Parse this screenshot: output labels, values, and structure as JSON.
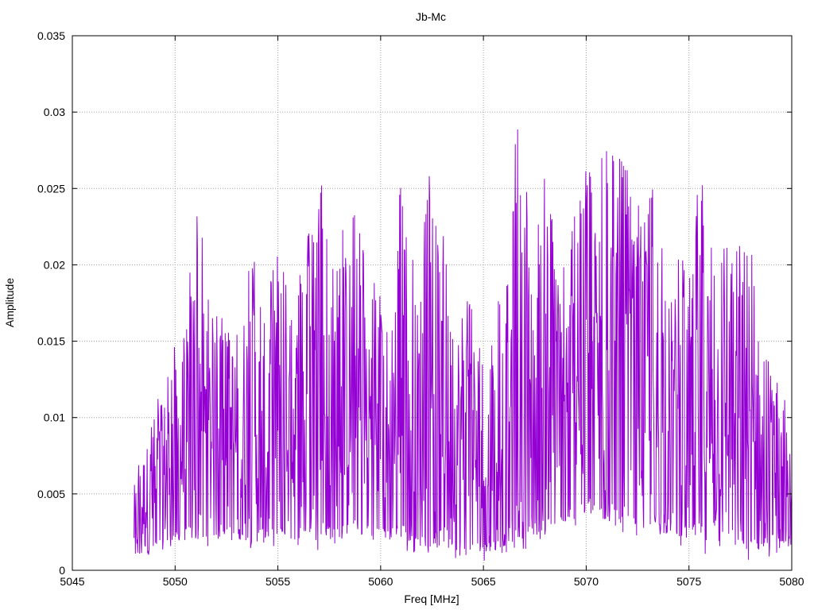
{
  "chart_data": {
    "type": "line",
    "title": "Jb-Mc",
    "xlabel": "Freq [MHz]",
    "ylabel": "Amplitude",
    "xlim": [
      5045,
      5080
    ],
    "ylim": [
      0,
      0.035
    ],
    "grid": true,
    "line_color": "#9400d3",
    "x_ticks": [
      5045,
      5050,
      5055,
      5060,
      5065,
      5070,
      5075,
      5080
    ],
    "x_tick_labels": [
      "5045",
      "5050",
      "5055",
      "5060",
      "5065",
      "5070",
      "5075",
      "5080"
    ],
    "y_ticks": [
      0,
      0.005,
      0.01,
      0.015,
      0.02,
      0.025,
      0.03,
      0.035
    ],
    "y_tick_labels": [
      "0",
      "0.005",
      "0.01",
      "0.015",
      "0.02",
      "0.025",
      "0.03",
      "0.035"
    ],
    "series": [
      {
        "x_start": 5048.0,
        "x_end": 5080.0,
        "envelope_peaks": [
          [
            5048.0,
            0.0062
          ],
          [
            5048.5,
            0.009
          ],
          [
            5049.0,
            0.0105
          ],
          [
            5049.5,
            0.013
          ],
          [
            5050.0,
            0.015
          ],
          [
            5050.5,
            0.017
          ],
          [
            5050.8,
            0.0218
          ],
          [
            5051.1,
            0.0263
          ],
          [
            5051.5,
            0.018
          ],
          [
            5052.0,
            0.017
          ],
          [
            5052.5,
            0.0175
          ],
          [
            5053.0,
            0.018
          ],
          [
            5053.5,
            0.02
          ],
          [
            5053.7,
            0.024
          ],
          [
            5054.0,
            0.018
          ],
          [
            5054.5,
            0.0185
          ],
          [
            5054.9,
            0.0252
          ],
          [
            5055.5,
            0.0185
          ],
          [
            5056.0,
            0.0195
          ],
          [
            5056.5,
            0.0224
          ],
          [
            5056.9,
            0.0248
          ],
          [
            5057.4,
            0.0274
          ],
          [
            5057.9,
            0.02
          ],
          [
            5058.3,
            0.0242
          ],
          [
            5058.9,
            0.0238
          ],
          [
            5059.5,
            0.02
          ],
          [
            5060.0,
            0.018
          ],
          [
            5060.5,
            0.019
          ],
          [
            5060.9,
            0.0279
          ],
          [
            5061.4,
            0.021
          ],
          [
            5061.8,
            0.02
          ],
          [
            5062.4,
            0.0264
          ],
          [
            5062.9,
            0.026
          ],
          [
            5063.5,
            0.016
          ],
          [
            5064.0,
            0.021
          ],
          [
            5064.5,
            0.018
          ],
          [
            5065.0,
            0.0165
          ],
          [
            5065.5,
            0.0175
          ],
          [
            5066.0,
            0.0185
          ],
          [
            5066.5,
            0.0289
          ],
          [
            5066.7,
            0.0302
          ],
          [
            5067.2,
            0.024
          ],
          [
            5067.8,
            0.0256
          ],
          [
            5068.2,
            0.0258
          ],
          [
            5068.8,
            0.02
          ],
          [
            5069.5,
            0.024
          ],
          [
            5070.0,
            0.0278
          ],
          [
            5070.4,
            0.025
          ],
          [
            5070.9,
            0.03
          ],
          [
            5071.4,
            0.027
          ],
          [
            5071.8,
            0.0294
          ],
          [
            5072.3,
            0.025
          ],
          [
            5072.8,
            0.023
          ],
          [
            5073.4,
            0.0268
          ],
          [
            5073.9,
            0.02
          ],
          [
            5074.5,
            0.021
          ],
          [
            5075.0,
            0.02
          ],
          [
            5075.6,
            0.0285
          ],
          [
            5076.2,
            0.02
          ],
          [
            5076.8,
            0.0218
          ],
          [
            5077.3,
            0.021
          ],
          [
            5077.8,
            0.0248
          ],
          [
            5078.3,
            0.0185
          ],
          [
            5078.8,
            0.014
          ],
          [
            5079.3,
            0.0125
          ],
          [
            5079.8,
            0.012
          ],
          [
            5080.0,
            0.006
          ]
        ],
        "envelope_floor": [
          [
            5048.0,
            0.0008
          ],
          [
            5050.0,
            0.002
          ],
          [
            5055.0,
            0.002
          ],
          [
            5060.0,
            0.002
          ],
          [
            5065.0,
            0.001
          ],
          [
            5070.0,
            0.0035
          ],
          [
            5075.0,
            0.002
          ],
          [
            5078.0,
            0.001
          ],
          [
            5080.0,
            0.0015
          ]
        ],
        "sample_count": 1400
      }
    ]
  }
}
